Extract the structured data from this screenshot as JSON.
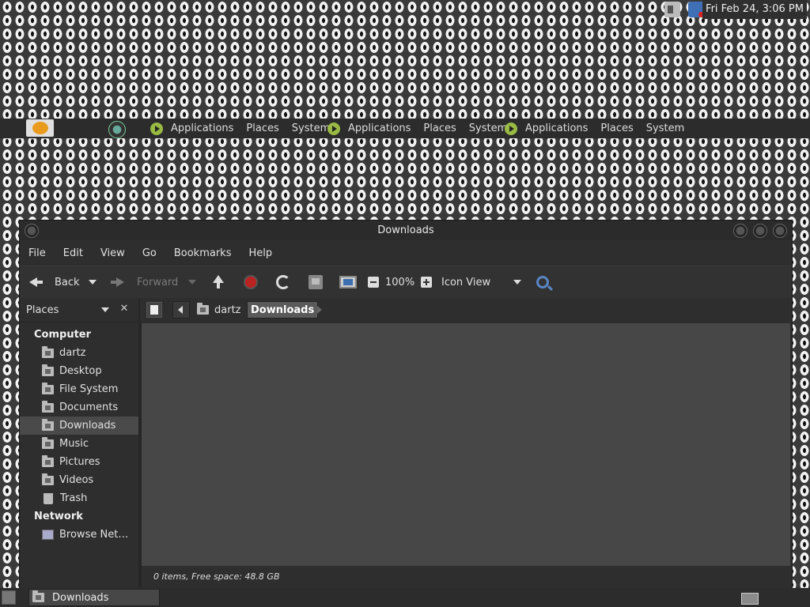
{
  "top_panel": {
    "clock": "Fri Feb 24,  3:06 PM",
    "tray_icons": [
      "volume-icon",
      "network-icon"
    ]
  },
  "panel_menu": {
    "groups": [
      {
        "applications": "Applications",
        "places": "Places",
        "system": "System"
      },
      {
        "applications": "Applications",
        "places": "Places",
        "system": "System"
      },
      {
        "applications": "Applications",
        "places": "Places",
        "system": "System"
      }
    ]
  },
  "window": {
    "title": "Downloads",
    "menubar": [
      "File",
      "Edit",
      "View",
      "Go",
      "Bookmarks",
      "Help"
    ],
    "toolbar": {
      "back": "Back",
      "forward": "Forward",
      "zoom": "100%",
      "view_mode": "Icon View"
    },
    "sidebar": {
      "header": "Places",
      "close": "✕",
      "computer_heading": "Computer",
      "items": [
        {
          "label": "dartz",
          "icon": "home-folder-icon"
        },
        {
          "label": "Desktop",
          "icon": "desktop-folder-icon"
        },
        {
          "label": "File System",
          "icon": "drive-icon"
        },
        {
          "label": "Documents",
          "icon": "folder-icon"
        },
        {
          "label": "Downloads",
          "icon": "folder-icon",
          "selected": true
        },
        {
          "label": "Music",
          "icon": "folder-icon"
        },
        {
          "label": "Pictures",
          "icon": "folder-icon"
        },
        {
          "label": "Videos",
          "icon": "folder-icon"
        },
        {
          "label": "Trash",
          "icon": "trash-icon"
        }
      ],
      "network_heading": "Network",
      "network_items": [
        {
          "label": "Browse Net…",
          "icon": "network-icon"
        }
      ]
    },
    "pathbar": {
      "home": "dartz",
      "current": "Downloads"
    },
    "status": "0 items, Free space: 48.8 GB"
  },
  "taskbar": {
    "task": "Downloads"
  },
  "colors": {
    "panel_bg": "#2c2c2c",
    "window_bg": "#2e2e2e",
    "content_bg": "#474747",
    "selection": "#4a4a4a",
    "accent_green": "#99bb44"
  }
}
